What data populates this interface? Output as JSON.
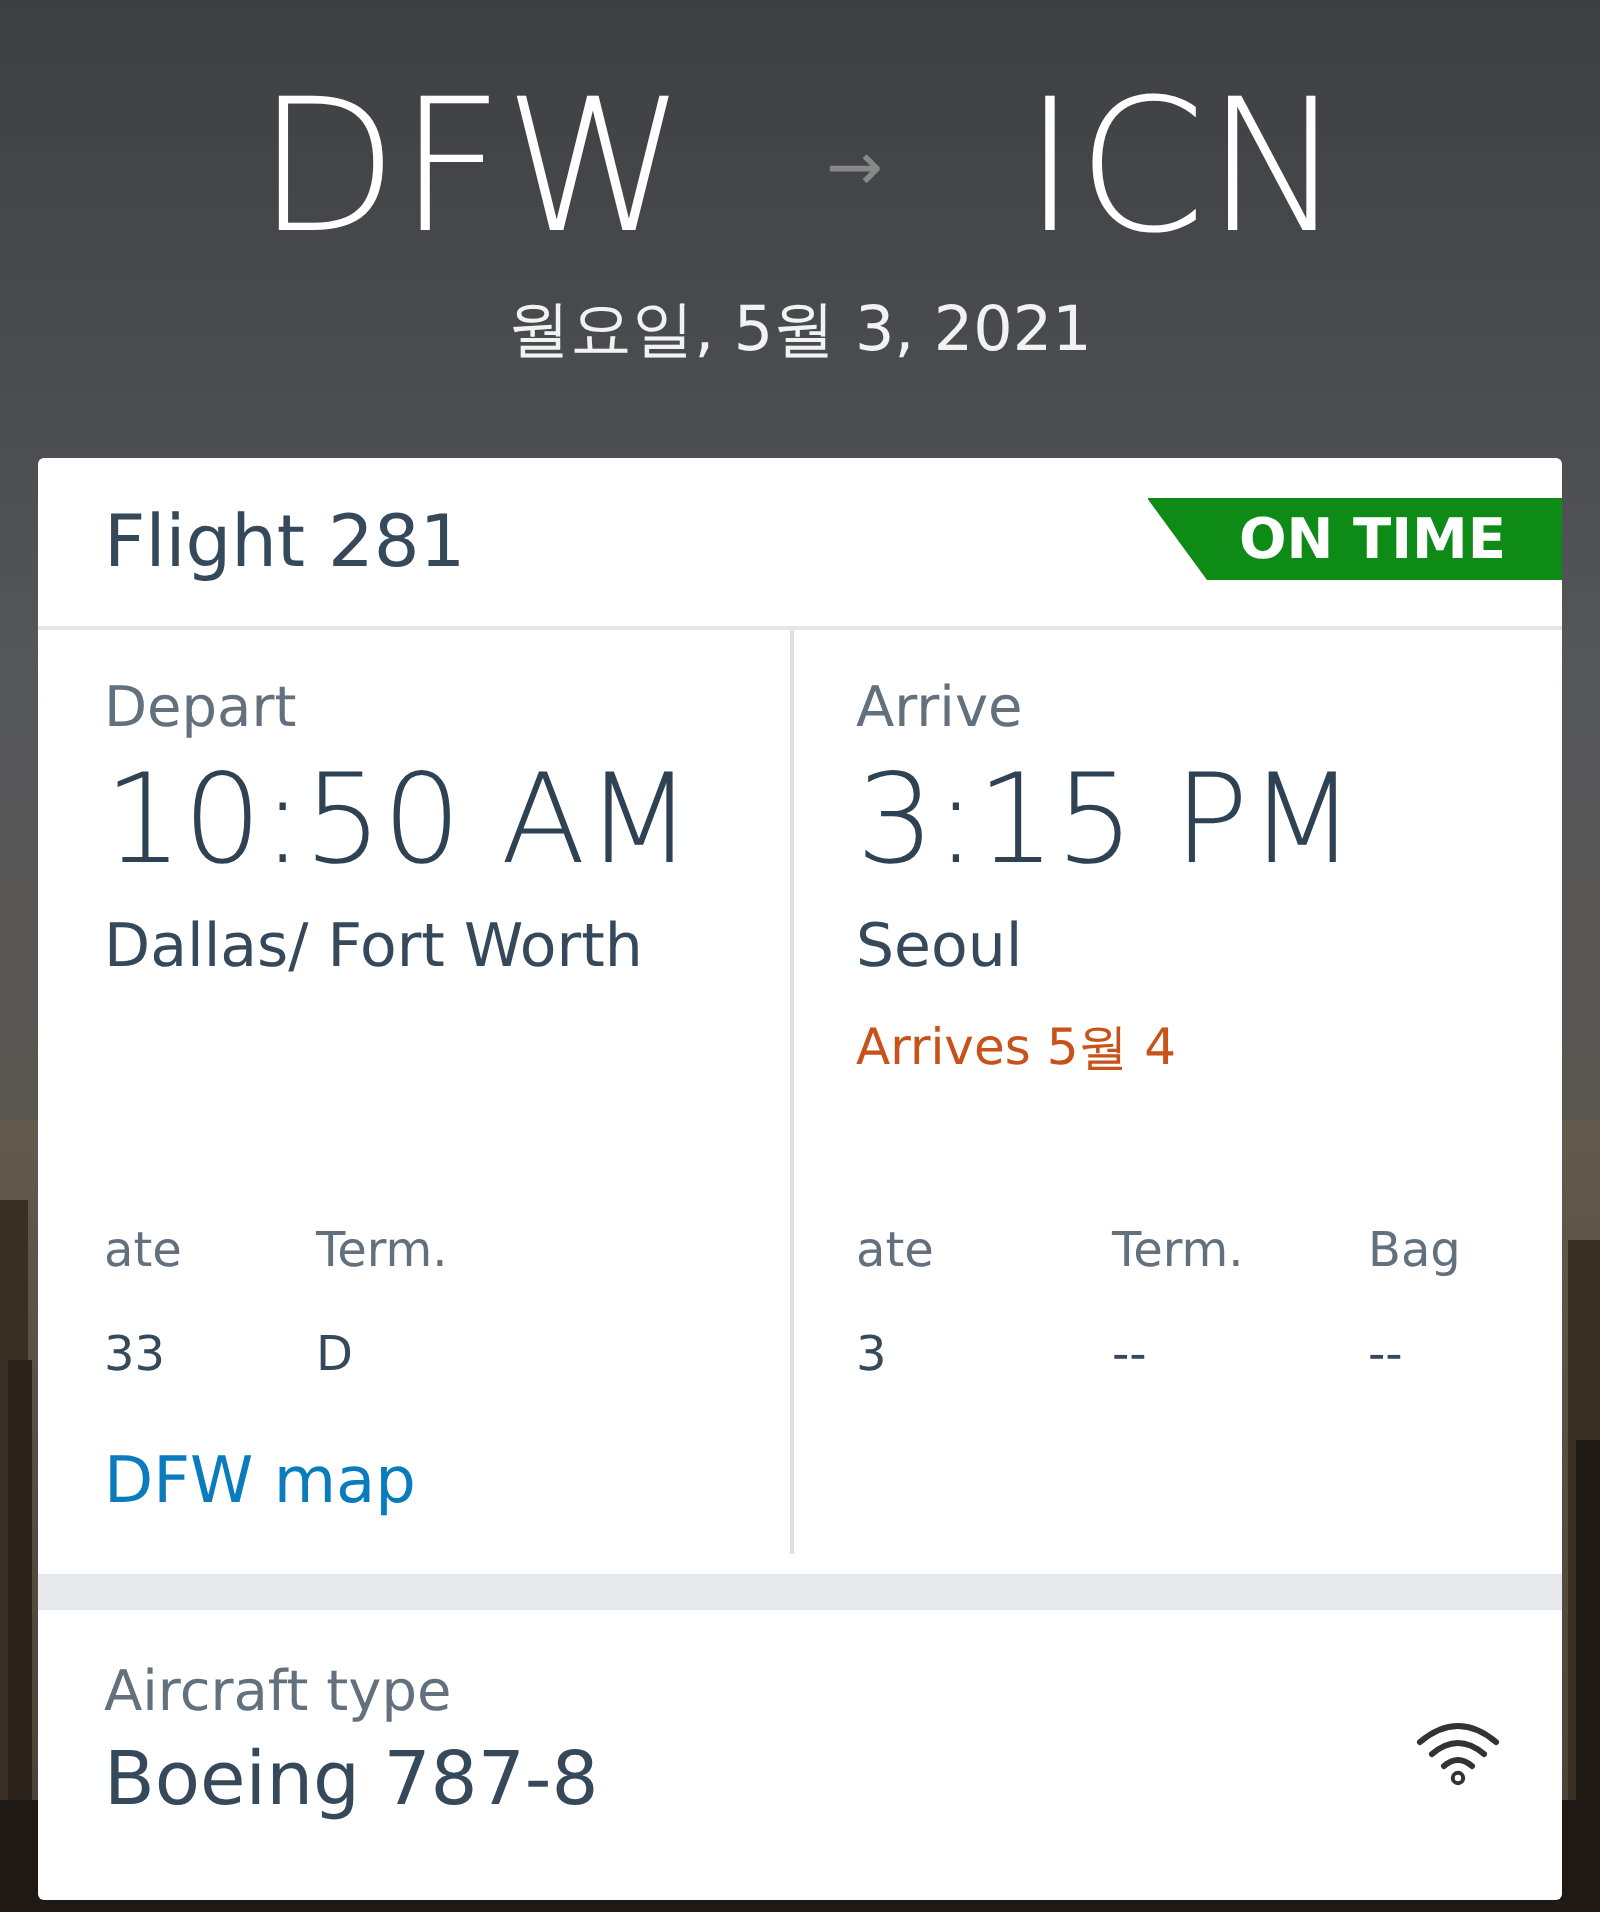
{
  "route": {
    "origin": "DFW",
    "arrow": "→",
    "destination": "ICN",
    "date": "월요일, 5월 3, 2021"
  },
  "flight": {
    "title": "Flight 281",
    "status": {
      "label": "ON TIME",
      "kind": "on_time"
    }
  },
  "depart": {
    "label": "Depart",
    "time": "10:50 AM",
    "city": "Dallas/ Fort Worth",
    "info": [
      {
        "label": "ate",
        "value": "33"
      },
      {
        "label": "Term.",
        "value": "D"
      }
    ],
    "link": "DFW map"
  },
  "arrive": {
    "label": "Arrive",
    "time": "3:15 PM",
    "city": "Seoul",
    "note": "Arrives 5월 4",
    "info": [
      {
        "label": "ate",
        "value": "3"
      },
      {
        "label": "Term.",
        "value": "--"
      },
      {
        "label": "Bag",
        "value": "--"
      }
    ]
  },
  "aircraft": {
    "label": "Aircraft type",
    "value": "Boeing 787-8"
  }
}
